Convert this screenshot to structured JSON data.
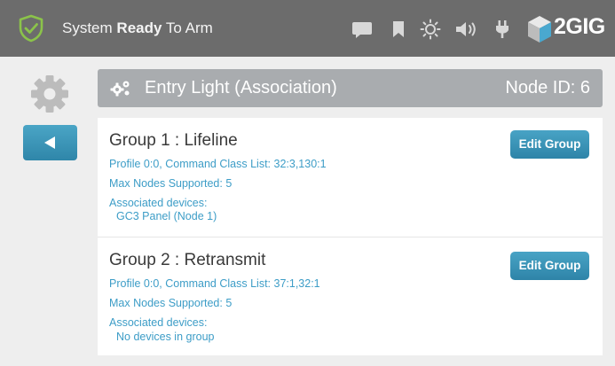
{
  "status": {
    "prefix": "System",
    "bold": "Ready",
    "suffix": "To Arm"
  },
  "icons": [
    "shield-check-icon",
    "message-icon",
    "bookmark-icon",
    "brightness-icon",
    "volume-icon",
    "plug-icon",
    "2gig-cube-icon",
    "gear-icon",
    "back-arrow-icon",
    "association-icon"
  ],
  "brand": "2GIG",
  "header": {
    "title": "Entry Light (Association)",
    "node": "Node ID: 6"
  },
  "groups": [
    {
      "title": "Group 1 : Lifeline",
      "profile": "Profile 0:0, Command Class List: 32:3,130:1",
      "max_nodes": "Max Nodes Supported: 5",
      "assoc_label": "Associated devices:",
      "assoc_value": "GC3 Panel (Node 1)",
      "button": "Edit Group"
    },
    {
      "title": "Group 2 : Retransmit",
      "profile": "Profile 0:0, Command Class List: 37:1,32:1",
      "max_nodes": "Max Nodes Supported: 5",
      "assoc_label": "Associated devices:",
      "assoc_value": "No devices in group",
      "button": "Edit Group"
    }
  ],
  "colors": {
    "topbar": "#6c6c6c",
    "accent": "#3d9dc7",
    "shield_green": "#8bc34a",
    "header_bar": "#a9acaf"
  }
}
